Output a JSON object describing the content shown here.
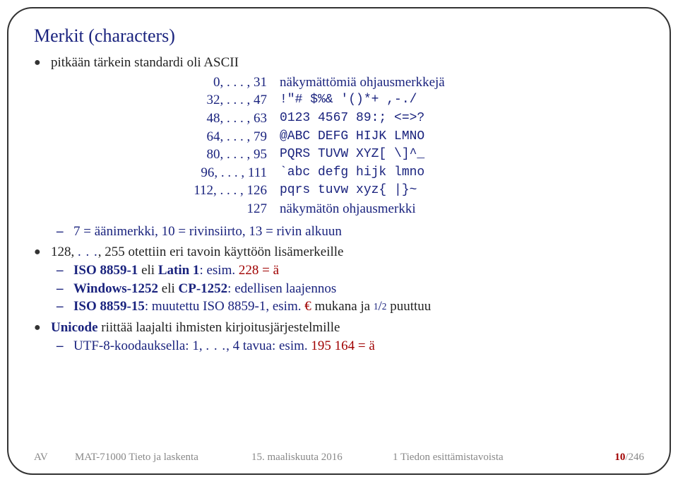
{
  "title": "Merkit (characters)",
  "bullet1": "pitkään tärkein standardi oli ASCII",
  "ascii": {
    "r1c1": "0, . . . , 31",
    "r1c2": "näkymättömiä ohjausmerkkejä",
    "r2c1": "32, . . . , 47",
    "r2c2": "!\"# $%& '()*+ ,-./",
    "r3c1": "48, . . . , 63",
    "r3c2": "0123 4567 89:; <=>?",
    "r4c1": "64, . . . , 79",
    "r4c2": "@ABC DEFG HIJK LMNO",
    "r5c1": "80, . . . , 95",
    "r5c2": "PQRS TUVW XYZ[ \\]^_",
    "r6c1": "96, . . . , 111",
    "r6c2": "`abc defg hijk lmno",
    "r7c1": "112, . . . , 126",
    "r7c2": "pqrs tuvw xyz{ |}~",
    "r8c1": "127",
    "r8c2": "näkymätön ohjausmerkki"
  },
  "sub1": "7 = äänimerkki, 10 = rivinsiirto, 13 = rivin alkuun",
  "bullet2a": "128, ",
  "bullet2dots": ". . .",
  "bullet2b": ", 255 otettiin eri tavoin käyttöön lisämerkeille",
  "sub2a_iso": "ISO 8859-1",
  "sub2a_eli": " eli ",
  "sub2a_latin": "Latin 1",
  "sub2a_rest": ": esim.",
  "sub2a_red": " 228 = ä",
  "sub2b_win": "Windows-1252",
  "sub2b_eli": " eli ",
  "sub2b_cp": "CP-1252",
  "sub2b_rest": ": edellisen laajennos",
  "sub2c_iso": "ISO 8859-15",
  "sub2c_rest": ": muutettu ISO 8859-1, esim.",
  "sub2c_euro": " €",
  "sub2c_mukana": " mukana ja ",
  "sub2c_num": "1",
  "sub2c_slash": "/",
  "sub2c_den": "2",
  "sub2c_pu": " puuttuu",
  "bullet3_uni": "Unicode",
  "bullet3_rest": " riittää laajalti ihmisten kirjoitusjärjestelmille",
  "sub3a": "UTF-8-koodauksella: 1, ",
  "sub3dots": ". . .",
  "sub3b": ", 4 tavua: esim.",
  "sub3_red": " 195 164 = ä",
  "footer": {
    "author": "AV",
    "course": "MAT-71000 Tieto ja laskenta",
    "date": "15. maaliskuuta 2016",
    "section": "1 Tiedon esittämistavoista",
    "page_cur": "10",
    "page_sep": "/",
    "page_tot": "246"
  }
}
